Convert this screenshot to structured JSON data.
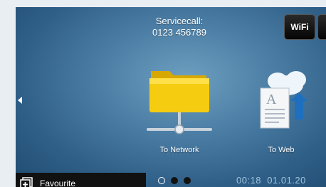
{
  "header": {
    "service_line1": "Servicecall:",
    "service_line2": "0123 456789",
    "wifi_label": "WiFi"
  },
  "tiles": [
    {
      "label": "To Network",
      "icon": "folder-network-icon"
    },
    {
      "label": "To Web",
      "icon": "document-cloud-icon"
    }
  ],
  "footer": {
    "favourite_label": "Favourite",
    "page_dots": 3,
    "active_page": 2,
    "time": "00:18",
    "date": "01.01.20"
  },
  "colors": {
    "background": "#4d7fa6",
    "folder": "#f3c400",
    "footer_bar": "#111111",
    "status_text": "#9fc3dd"
  }
}
